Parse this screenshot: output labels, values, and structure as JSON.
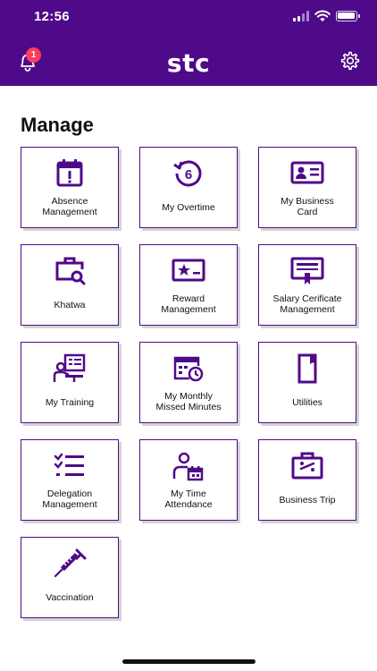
{
  "status_bar": {
    "time": "12:56"
  },
  "header": {
    "logo": "stc",
    "notification_count": "1",
    "accent_color": "#4f0a8a",
    "badge_color": "#ff3b5c"
  },
  "page": {
    "title": "Manage"
  },
  "tiles": [
    {
      "label": "Absence\nManagement",
      "icon": "calendar-alert-icon"
    },
    {
      "label": "My Overtime",
      "icon": "overtime-clock-icon"
    },
    {
      "label": "My Business\nCard",
      "icon": "business-card-icon"
    },
    {
      "label": "Khatwa",
      "icon": "briefcase-search-icon"
    },
    {
      "label": "Reward\nManagement",
      "icon": "reward-certificate-icon"
    },
    {
      "label": "Salary Cerificate\nManagement",
      "icon": "salary-certificate-icon"
    },
    {
      "label": "My Training",
      "icon": "training-board-icon"
    },
    {
      "label": "My Monthly\nMissed Minutes",
      "icon": "calendar-clock-icon"
    },
    {
      "label": "Utilities",
      "icon": "folder-icon"
    },
    {
      "label": "Delegation\nManagement",
      "icon": "checklist-icon"
    },
    {
      "label": "My Time\nAttendance",
      "icon": "person-calendar-icon"
    },
    {
      "label": "Business Trip",
      "icon": "suitcase-icon"
    },
    {
      "label": "Vaccination",
      "icon": "syringe-icon"
    }
  ]
}
